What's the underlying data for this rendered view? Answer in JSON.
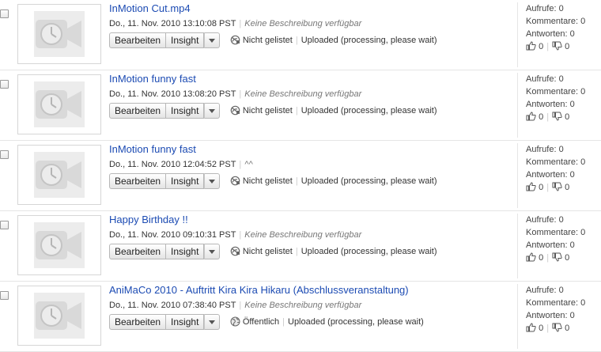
{
  "labels": {
    "edit": "Bearbeiten",
    "insight": "Insight",
    "views": "Aufrufe:",
    "comments": "Kommentare:",
    "replies": "Antworten:"
  },
  "videos": [
    {
      "title": "InMotion Cut.mp4",
      "date": "Do., 11. Nov. 2010 13:10:08 PST",
      "description": "Keine Beschreibung verfügbar",
      "privacy": "Nicht gelistet",
      "privacy_icon": "unlisted-icon",
      "status": "Uploaded (processing, please wait)",
      "views": "0",
      "comments": "0",
      "replies": "0",
      "likes": "0",
      "dislikes": "0"
    },
    {
      "title": "InMotion funny fast",
      "date": "Do., 11. Nov. 2010 13:08:20 PST",
      "description": "Keine Beschreibung verfügbar",
      "privacy": "Nicht gelistet",
      "privacy_icon": "unlisted-icon",
      "status": "Uploaded (processing, please wait)",
      "views": "0",
      "comments": "0",
      "replies": "0",
      "likes": "0",
      "dislikes": "0"
    },
    {
      "title": "InMotion funny fast",
      "date": "Do., 11. Nov. 2010 12:04:52 PST",
      "description": "^^",
      "privacy": "Nicht gelistet",
      "privacy_icon": "unlisted-icon",
      "status": "Uploaded (processing, please wait)",
      "views": "0",
      "comments": "0",
      "replies": "0",
      "likes": "0",
      "dislikes": "0"
    },
    {
      "title": "Happy Birthday !!",
      "date": "Do., 11. Nov. 2010 09:10:31 PST",
      "description": "Keine Beschreibung verfügbar",
      "privacy": "Nicht gelistet",
      "privacy_icon": "unlisted-icon",
      "status": "Uploaded (processing, please wait)",
      "views": "0",
      "comments": "0",
      "replies": "0",
      "likes": "0",
      "dislikes": "0"
    },
    {
      "title": "AniMaCo 2010 - Auftritt Kira Kira Hikaru (Abschlussveranstaltung)",
      "date": "Do., 11. Nov. 2010 07:38:40 PST",
      "description": "Keine Beschreibung verfügbar",
      "privacy": "Öffentlich",
      "privacy_icon": "globe-icon",
      "status": "Uploaded (processing, please wait)",
      "views": "0",
      "comments": "0",
      "replies": "0",
      "likes": "0",
      "dislikes": "0"
    }
  ]
}
